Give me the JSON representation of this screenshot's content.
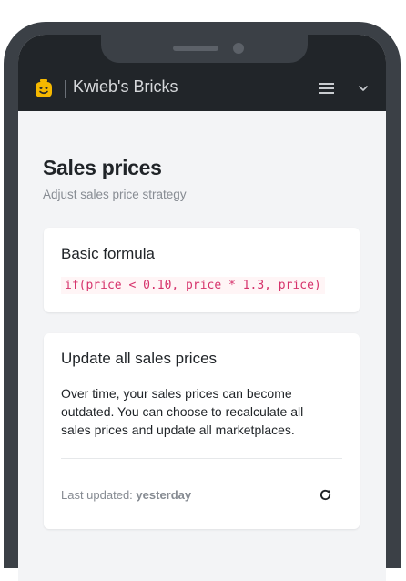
{
  "header": {
    "brand": "Kwieb's Bricks",
    "logo_icon": "lego-head-icon",
    "menu_icon": "hamburger-menu-icon",
    "dropdown_icon": "chevron-down-icon"
  },
  "page": {
    "title": "Sales prices",
    "subtitle": "Adjust sales price strategy"
  },
  "formula_card": {
    "title": "Basic formula",
    "formula": "if(price < 0.10, price * 1.3, price)"
  },
  "update_card": {
    "title": "Update all sales prices",
    "description": "Over time, your sales prices can become outdated. You can choose to recalculate all sales prices and update all marketplaces.",
    "last_updated_label": "Last updated:",
    "last_updated_value": "yesterday",
    "refresh_icon": "refresh-icon"
  },
  "colors": {
    "navbar": "#212529",
    "page_background": "#f3f4f6",
    "code_text": "#d6336c",
    "logo_yellow": "#f5b800"
  }
}
